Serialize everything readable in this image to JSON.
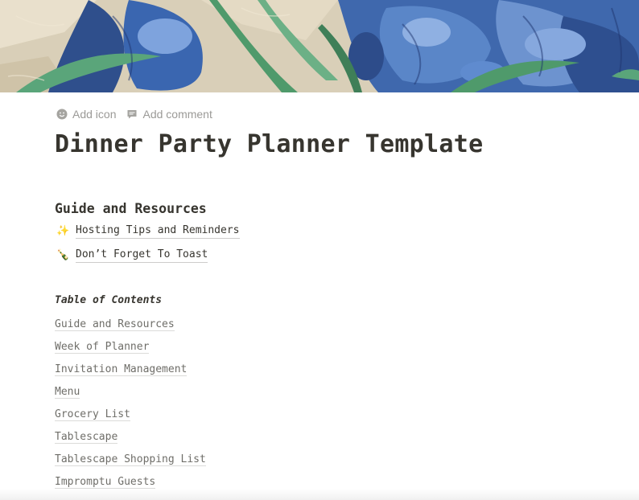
{
  "page": {
    "controls": {
      "add_icon": "Add icon",
      "add_comment": "Add comment"
    },
    "title": "Dinner Party Planner Template",
    "guide_section": {
      "heading": "Guide and Resources",
      "links": [
        {
          "emoji": "✨",
          "label": "Hosting Tips and Reminders"
        },
        {
          "emoji": "🍾",
          "label": "Don’t Forget To Toast"
        }
      ]
    },
    "toc": {
      "title": "Table of Contents",
      "items": [
        "Guide and Resources",
        "Week of Planner",
        "Invitation Management",
        "Menu",
        "Grocery List",
        "Tablescape",
        "Tablescape Shopping List",
        "Impromptu Guests"
      ]
    }
  },
  "colors": {
    "text": "#37352f",
    "muted": "#9b9a97",
    "link_muted": "#6f6e69",
    "cover_blue": "#3d63a8",
    "cover_green": "#4f9a6b",
    "cover_cream": "#e6dcc6"
  },
  "icons": {
    "add_icon": "smiley-icon",
    "add_comment": "comment-icon"
  }
}
